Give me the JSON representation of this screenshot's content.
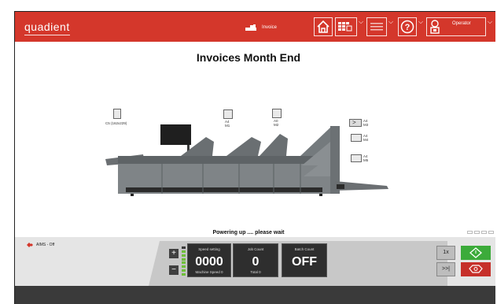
{
  "header": {
    "brand": "quadient",
    "job_name": "Invoice",
    "user": "Operator",
    "home_icon": "home-icon",
    "view_icon": "grid-view-icon",
    "list_icon": "list-icon",
    "help_icon": "help-icon",
    "user_icon": "user-icon"
  },
  "page": {
    "title": "Invoices Month End"
  },
  "machine": {
    "feeder_labels": {
      "envelope": "C5 (162x229)",
      "m1": [
        "A4",
        "M1"
      ],
      "m2": [
        "A0",
        "M2"
      ],
      "m3": [
        "A4",
        "M3"
      ],
      "m4": [
        "A4",
        "M4"
      ],
      "m5": [
        "A4",
        "M5"
      ]
    }
  },
  "status": {
    "message": "Powering up .... please wait"
  },
  "bottom": {
    "aims_label": "AIMS - Off",
    "plus": "+",
    "minus": "−",
    "speed": {
      "caption": "Speed setting",
      "value": "0000",
      "sub": "Machine Speed 0"
    },
    "job_count": {
      "caption": "Job Count",
      "value": "0",
      "sub": "Total 0"
    },
    "batch_count": {
      "caption": "Batch Count",
      "value": "OFF"
    },
    "one_x": "1x",
    "skip": ">>|"
  },
  "colors": {
    "accent": "#d4372b",
    "start": "#3cab3a",
    "stop": "#c6302a",
    "panel": "#2e2e2e"
  }
}
